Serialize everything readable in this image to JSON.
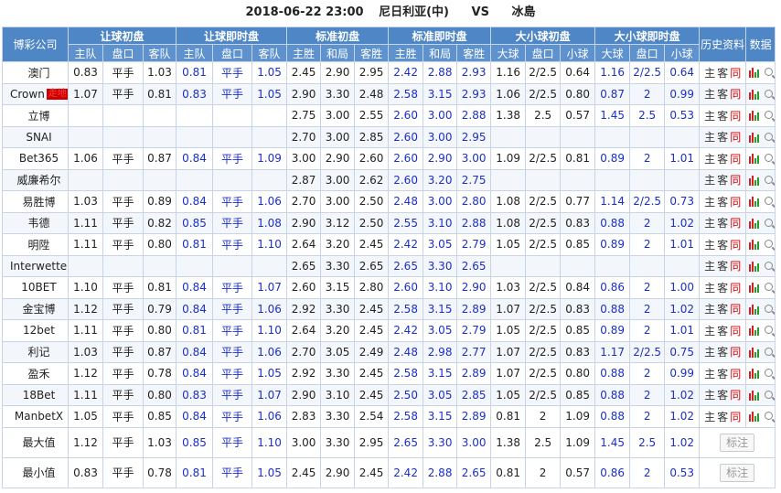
{
  "header": {
    "datetime": "2018-06-22 23:00",
    "home": "尼日利亚(中)",
    "vs": "VS",
    "away": "冰島"
  },
  "columns": {
    "company": "博彩公司",
    "groups": [
      "让球初盘",
      "让球即时盘",
      "标准初盘",
      "标准即时盘",
      "大小球初盘",
      "大小球即时盘"
    ],
    "history": "历史资料",
    "data": "数据",
    "sub": [
      "主队",
      "盘口",
      "客队",
      "主队",
      "盘口",
      "客队",
      "主胜",
      "和局",
      "客胜",
      "主胜",
      "和局",
      "客胜",
      "大球",
      "盘口",
      "小球",
      "大球",
      "盘口",
      "小球"
    ]
  },
  "history_labels": [
    "主",
    "客",
    "同"
  ],
  "rows": [
    {
      "company": "澳门",
      "badge": "",
      "cells": [
        "0.83",
        "平手",
        "1.03",
        "0.81",
        "平手",
        "1.05",
        "2.45",
        "2.90",
        "2.95",
        "2.42",
        "2.88",
        "2.93",
        "1.16",
        "2/2.5",
        "0.64",
        "1.16",
        "2/2.5",
        "0.64"
      ]
    },
    {
      "company": "Crown",
      "badge": "走地",
      "cells": [
        "1.07",
        "平手",
        "0.81",
        "0.83",
        "平手",
        "1.05",
        "2.90",
        "3.30",
        "2.48",
        "2.58",
        "3.15",
        "2.93",
        "1.06",
        "2/2.5",
        "0.80",
        "0.87",
        "2",
        "0.99"
      ]
    },
    {
      "company": "立博",
      "badge": "",
      "cells": [
        "",
        "",
        "",
        "",
        "",
        "",
        "2.75",
        "3.00",
        "2.55",
        "2.60",
        "3.00",
        "2.88",
        "1.38",
        "2.5",
        "0.57",
        "1.45",
        "2.5",
        "0.53"
      ]
    },
    {
      "company": "SNAI",
      "badge": "",
      "cells": [
        "",
        "",
        "",
        "",
        "",
        "",
        "2.70",
        "3.00",
        "2.85",
        "2.60",
        "3.00",
        "2.95",
        "",
        "",
        "",
        "",
        "",
        ""
      ]
    },
    {
      "company": "Bet365",
      "badge": "",
      "cells": [
        "1.06",
        "平手",
        "0.87",
        "0.84",
        "平手",
        "1.09",
        "3.00",
        "2.90",
        "2.60",
        "2.60",
        "2.90",
        "3.00",
        "1.09",
        "2/2.5",
        "0.81",
        "0.89",
        "2",
        "1.01"
      ]
    },
    {
      "company": "威廉希尔",
      "badge": "",
      "cells": [
        "",
        "",
        "",
        "",
        "",
        "",
        "2.87",
        "3.00",
        "2.62",
        "2.60",
        "3.20",
        "2.75",
        "",
        "",
        "",
        "",
        "",
        ""
      ]
    },
    {
      "company": "易胜博",
      "badge": "",
      "cells": [
        "1.03",
        "平手",
        "0.89",
        "0.84",
        "平手",
        "1.06",
        "2.70",
        "3.00",
        "2.50",
        "2.48",
        "3.00",
        "2.80",
        "1.08",
        "2/2.5",
        "0.77",
        "1.14",
        "2/2.5",
        "0.73"
      ]
    },
    {
      "company": "韦德",
      "badge": "",
      "cells": [
        "1.11",
        "平手",
        "0.82",
        "0.85",
        "平手",
        "1.08",
        "2.90",
        "3.12",
        "2.50",
        "2.55",
        "3.10",
        "2.88",
        "1.08",
        "2/2.5",
        "0.83",
        "0.88",
        "2",
        "1.02"
      ]
    },
    {
      "company": "明陞",
      "badge": "",
      "cells": [
        "1.11",
        "平手",
        "0.80",
        "0.81",
        "平手",
        "1.10",
        "2.64",
        "3.20",
        "2.45",
        "2.42",
        "3.05",
        "2.79",
        "1.05",
        "2/2.5",
        "0.85",
        "0.89",
        "2",
        "1.01"
      ]
    },
    {
      "company": "Interwetten",
      "badge": "",
      "cells": [
        "",
        "",
        "",
        "",
        "",
        "",
        "2.65",
        "3.30",
        "2.65",
        "2.65",
        "3.30",
        "2.65",
        "",
        "",
        "",
        "",
        "",
        ""
      ]
    },
    {
      "company": "10BET",
      "badge": "",
      "cells": [
        "1.10",
        "平手",
        "0.81",
        "0.84",
        "平手",
        "1.07",
        "2.60",
        "3.15",
        "2.80",
        "2.60",
        "3.10",
        "2.90",
        "1.03",
        "2/2.5",
        "0.84",
        "0.86",
        "2",
        "1.00"
      ]
    },
    {
      "company": "金宝博",
      "badge": "",
      "cells": [
        "1.12",
        "平手",
        "0.79",
        "0.84",
        "平手",
        "1.06",
        "2.92",
        "3.30",
        "2.45",
        "2.58",
        "3.15",
        "2.89",
        "1.07",
        "2/2.5",
        "0.83",
        "0.88",
        "2",
        "1.02"
      ]
    },
    {
      "company": "12bet",
      "badge": "",
      "cells": [
        "1.11",
        "平手",
        "0.80",
        "0.81",
        "平手",
        "1.10",
        "2.64",
        "3.20",
        "2.45",
        "2.42",
        "3.05",
        "2.79",
        "1.05",
        "2/2.5",
        "0.85",
        "0.89",
        "2",
        "1.01"
      ]
    },
    {
      "company": "利记",
      "badge": "",
      "cells": [
        "1.03",
        "平手",
        "0.87",
        "0.84",
        "平手",
        "1.06",
        "2.70",
        "3.05",
        "2.49",
        "2.48",
        "2.98",
        "2.77",
        "1.07",
        "2/2.5",
        "0.83",
        "1.17",
        "2/2.5",
        "0.75"
      ]
    },
    {
      "company": "盈禾",
      "badge": "",
      "cells": [
        "1.12",
        "平手",
        "0.78",
        "0.84",
        "平手",
        "1.05",
        "2.92",
        "3.30",
        "2.45",
        "2.58",
        "3.15",
        "2.89",
        "1.07",
        "2/2.5",
        "0.80",
        "0.88",
        "2",
        "0.99"
      ]
    },
    {
      "company": "18Bet",
      "badge": "",
      "cells": [
        "1.11",
        "平手",
        "0.80",
        "0.83",
        "平手",
        "1.07",
        "2.90",
        "3.10",
        "2.45",
        "2.50",
        "3.05",
        "2.85",
        "1.05",
        "2/2.5",
        "0.85",
        "0.88",
        "2",
        "1.02"
      ]
    },
    {
      "company": "ManbetX",
      "badge": "",
      "cells": [
        "1.05",
        "平手",
        "0.85",
        "0.84",
        "平手",
        "1.06",
        "2.83",
        "3.30",
        "2.54",
        "2.58",
        "3.15",
        "2.89",
        "0.81",
        "2",
        "1.09",
        "0.88",
        "2",
        "1.02"
      ]
    }
  ],
  "summary": [
    {
      "label": "最大值",
      "button": "标注",
      "cells": [
        "1.12",
        "平手",
        "1.03",
        "0.85",
        "平手",
        "1.10",
        "3.00",
        "3.30",
        "2.95",
        "2.65",
        "3.30",
        "3.00",
        "1.38",
        "2.5",
        "1.09",
        "1.45",
        "2.5",
        "1.02"
      ]
    },
    {
      "label": "最小值",
      "button": "标注",
      "cells": [
        "0.83",
        "平手",
        "0.78",
        "0.81",
        "平手",
        "1.05",
        "2.45",
        "2.90",
        "2.45",
        "2.42",
        "2.88",
        "2.65",
        "0.81",
        "2",
        "0.57",
        "0.86",
        "2",
        "0.53"
      ]
    }
  ]
}
